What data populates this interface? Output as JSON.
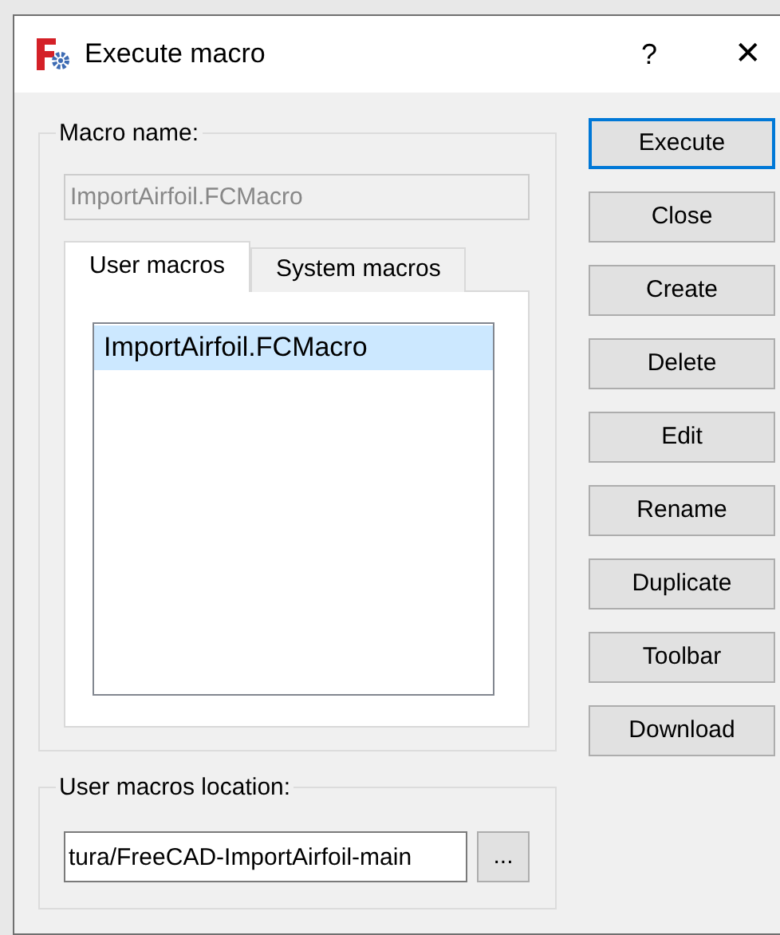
{
  "window": {
    "title": "Execute macro",
    "help": "?",
    "close": "✕"
  },
  "macro_name": {
    "label": "Macro name:",
    "value": "ImportAirfoil.FCMacro",
    "disabled": true
  },
  "tabs": [
    {
      "label": "User macros",
      "selected": true
    },
    {
      "label": "System macros",
      "selected": false
    }
  ],
  "macros": [
    {
      "name": "ImportAirfoil.FCMacro",
      "selected": true
    }
  ],
  "buttons": [
    {
      "label": "Execute",
      "default": true
    },
    {
      "label": "Close",
      "default": false
    },
    {
      "label": "Create",
      "default": false
    },
    {
      "label": "Delete",
      "default": false
    },
    {
      "label": "Edit",
      "default": false
    },
    {
      "label": "Rename",
      "default": false
    },
    {
      "label": "Duplicate",
      "default": false
    },
    {
      "label": "Toolbar",
      "default": false
    },
    {
      "label": "Download",
      "default": false
    }
  ],
  "location": {
    "label": "User macros location:",
    "value": "tura/FreeCAD-ImportAirfoil-main",
    "browse": "..."
  }
}
